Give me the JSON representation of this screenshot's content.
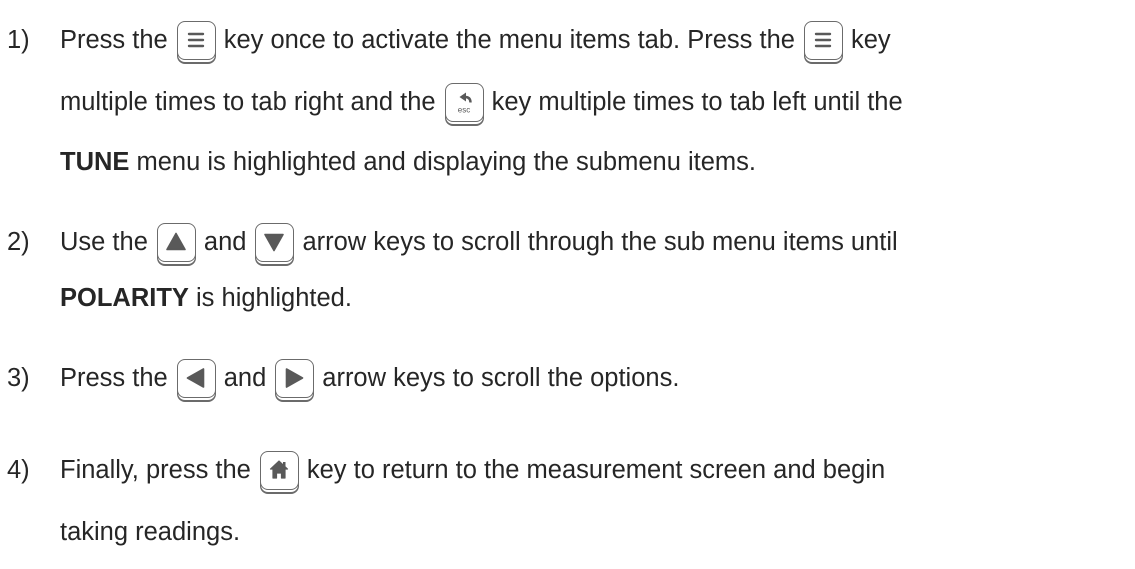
{
  "steps": [
    {
      "number": "1)",
      "line1": {
        "a": "Press the",
        "b": "key once to activate the menu items tab.  Press the",
        "c": "key"
      },
      "line2": {
        "a": "multiple times to tab right and the",
        "b": "key multiple times to tab left until the"
      },
      "line3": {
        "bold": "TUNE",
        "rest": " menu is highlighted and displaying the submenu items."
      }
    },
    {
      "number": "2)",
      "line1": {
        "a": "Use the",
        "b": "and",
        "c": "arrow keys to scroll through the sub menu items until"
      },
      "line2": {
        "bold": "POLARITY",
        "rest": " is highlighted."
      }
    },
    {
      "number": "3)",
      "line1": {
        "a": "Press the",
        "b": "and",
        "c": "arrow keys to scroll the options."
      }
    },
    {
      "number": "4)",
      "line1": {
        "a": "Finally, press the",
        "b": "key to return to the measurement screen and begin"
      },
      "line2": {
        "a": "taking readings."
      }
    }
  ],
  "keys": {
    "menu": "menu-icon",
    "esc": "esc-back-icon",
    "esc_label": "esc",
    "up": "up-arrow-icon",
    "down": "down-arrow-icon",
    "left": "left-arrow-icon",
    "right": "right-arrow-icon",
    "home": "home-icon"
  },
  "colors": {
    "text": "#262626",
    "key_border": "#6b6b6b",
    "key_glyph": "#595959"
  }
}
